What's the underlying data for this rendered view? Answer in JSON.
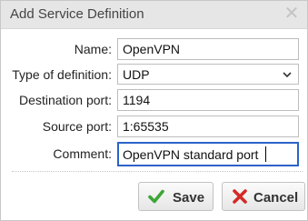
{
  "dialog": {
    "title": "Add Service Definition",
    "close_icon": "close-icon"
  },
  "form": {
    "name": {
      "label": "Name:",
      "value": "OpenVPN"
    },
    "type": {
      "label": "Type of definition:",
      "value": "UDP",
      "icon": "chevron-down-icon"
    },
    "destination_port": {
      "label": "Destination port:",
      "value": "1194"
    },
    "source_port": {
      "label": "Source port:",
      "value": "1:65535"
    },
    "comment": {
      "label": "Comment:",
      "value": "OpenVPN standard port"
    }
  },
  "buttons": {
    "save": {
      "label": "Save",
      "icon": "checkmark-icon",
      "icon_color": "#3ea636"
    },
    "cancel": {
      "label": "Cancel",
      "icon": "x-mark-icon",
      "icon_color": "#d42a26"
    }
  }
}
